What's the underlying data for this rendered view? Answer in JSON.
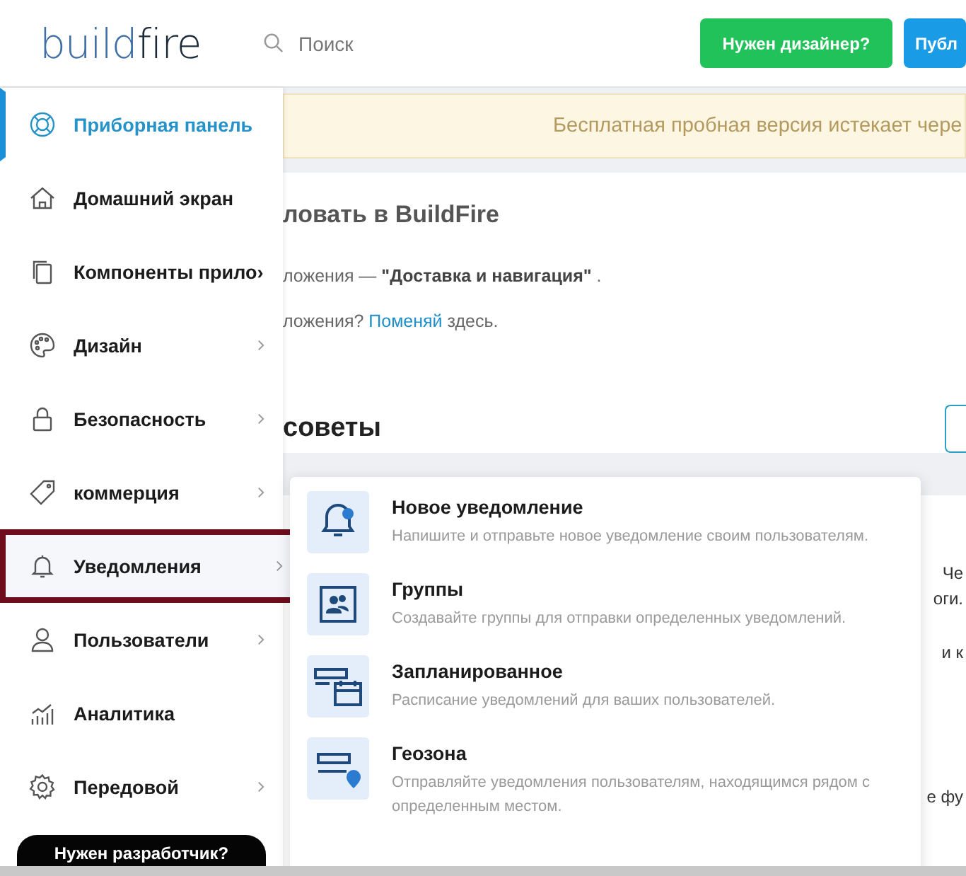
{
  "header": {
    "logo": [
      "build",
      "fire"
    ],
    "search": {
      "placeholder": "Поиск"
    },
    "buttons": [
      {
        "label": "Нужен дизайнер?",
        "kind": "green"
      },
      {
        "label": "Публ",
        "kind": "blue"
      }
    ]
  },
  "sidebar": {
    "items": [
      {
        "label": "Приборная панель",
        "selected": true,
        "highlighted": false,
        "submenu": false
      },
      {
        "label": "Домашний экран",
        "selected": false,
        "highlighted": false,
        "submenu": false
      },
      {
        "label": "Компоненты прило›",
        "selected": false,
        "highlighted": false,
        "submenu": false
      },
      {
        "label": "Дизайн",
        "selected": false,
        "highlighted": false,
        "submenu": true
      },
      {
        "label": "Безопасность",
        "selected": false,
        "highlighted": false,
        "submenu": true
      },
      {
        "label": "коммерция",
        "selected": false,
        "highlighted": false,
        "submenu": true
      },
      {
        "label": "Уведомления",
        "selected": false,
        "highlighted": true,
        "submenu": true
      },
      {
        "label": "Пользователи",
        "selected": false,
        "highlighted": false,
        "submenu": true
      },
      {
        "label": "Аналитика",
        "selected": false,
        "highlighted": false,
        "submenu": false
      },
      {
        "label": "Передовой",
        "selected": false,
        "highlighted": false,
        "submenu": true
      }
    ],
    "developer_button": "Нужен разработчик?"
  },
  "banner": "Бесплатная пробная версия истекает чере",
  "welcome": {
    "title": "ловать в BuildFire",
    "line_1": "ложения — **\"Доставка и навигация\"** .",
    "line_2_before": "ложения?",
    "line_2_link": "Поменяй",
    "line_2_after": "здесь."
  },
  "tips": {
    "title": "советы",
    "fragments": [
      "Че",
      "оги.",
      "и к",
      "е фу"
    ]
  },
  "notifications_menu": [
    {
      "title": "Новое уведомление",
      "description": "Напишите и отправьте новое уведомление своим пользователям."
    },
    {
      "title": "Группы",
      "description": "Создавайте группы для отправки определенных уведомлений."
    },
    {
      "title": "Запланированное",
      "description": "Расписание уведомлений для ваших пользователей."
    },
    {
      "title": "Геозона",
      "description": "Отправляйте уведомления пользователям, находящимся рядом с определенным местом."
    }
  ]
}
